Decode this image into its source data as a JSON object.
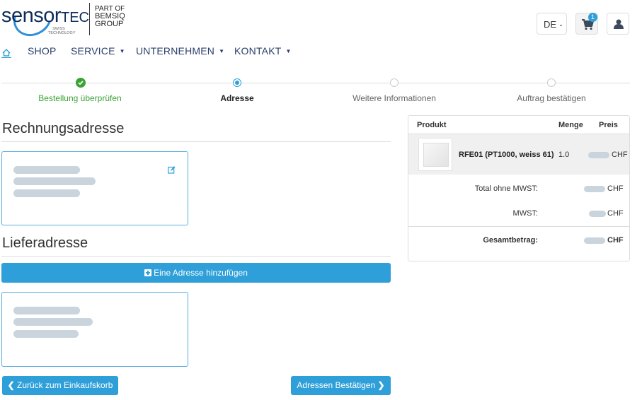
{
  "brand": {
    "name_part1": "sensor",
    "name_part2": "TEC",
    "tagline": "SWISS TECHNOLOGY",
    "parent_line1": "PART OF",
    "parent_line2": "BEMSIQ",
    "parent_line3": "GROUP"
  },
  "header": {
    "language": "DE",
    "cart_count": "1"
  },
  "nav": {
    "items": [
      {
        "label": "SHOP"
      },
      {
        "label": "SERVICE"
      },
      {
        "label": "UNTERNEHMEN"
      },
      {
        "label": "KONTAKT"
      }
    ]
  },
  "steps": [
    {
      "label": "Bestellung überprüfen",
      "state": "done"
    },
    {
      "label": "Adresse",
      "state": "active"
    },
    {
      "label": "Weitere Informationen",
      "state": "pending"
    },
    {
      "label": "Auftrag bestätigen",
      "state": "pending"
    }
  ],
  "billing": {
    "title": "Rechnungsadresse"
  },
  "shipping": {
    "title": "Lieferadresse",
    "add_button": "Eine Adresse hinzufügen"
  },
  "summary": {
    "headers": {
      "product": "Produkt",
      "quantity": "Menge",
      "price": "Preis"
    },
    "items": [
      {
        "name": "RFE01 (PT1000, weiss 61)",
        "quantity": "1.0",
        "currency": "CHF"
      }
    ],
    "total_without_vat_label": "Total ohne MWST:",
    "total_without_vat_currency": "CHF",
    "vat_label": "MWST:",
    "vat_currency": "CHF",
    "grand_total_label": "Gesamtbetrag:",
    "grand_total_currency": "CHF"
  },
  "actions": {
    "back": "Zurück zum Einkaufskorb",
    "confirm": "Adressen Bestätigen"
  },
  "colors": {
    "accent": "#2e9fd8",
    "success": "#3aa335",
    "brand_navy": "#0c2c5a"
  }
}
